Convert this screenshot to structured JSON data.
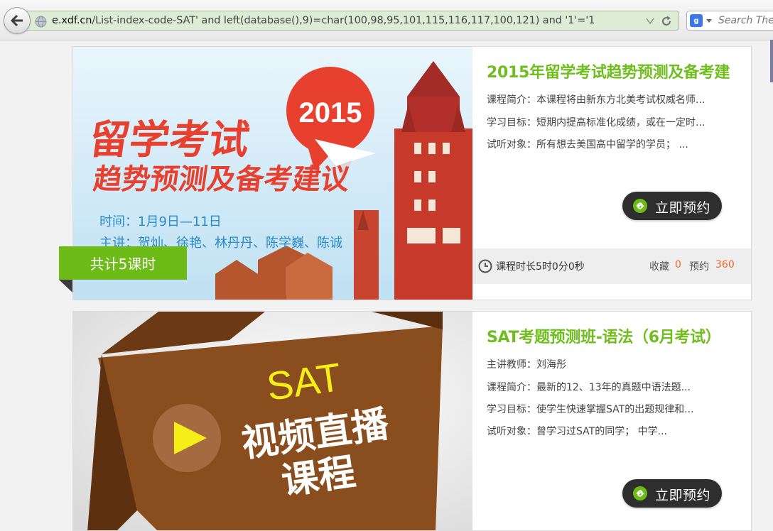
{
  "browser": {
    "url_domain": "e.xdf.cn",
    "url_path": "/List-index-code-SAT' and left(database(),9)=char(100,98,95,101,115,116,117,100,121) and '1'='1",
    "search_placeholder": "Search The",
    "search_engine_letter": "g"
  },
  "courses": [
    {
      "title": "2015年留学考试趋势预测及备考建",
      "lines": [
        "课程简介：本课程将由新东方北美考试权威名师...",
        "学习目标：短期内提高标准化成绩，或在一定时...",
        "试听对象：所有想去美国高中留学的学员； ..."
      ],
      "book_label": "立即预约",
      "lesson_badge": "共计5课时",
      "duration": "课程时长5时0分0秒",
      "favorites_label": "收藏",
      "favorites_count": "0",
      "bookings_label": "预约",
      "bookings_count": "360",
      "banner": {
        "year": "2015",
        "headline1": "留学考试",
        "headline2": "趋势预测及备考建议",
        "time": "时间：1月9日—11日",
        "speakers": "主讲：贺灿、徐艳、林丹丹、陈学巍、陈诚"
      }
    },
    {
      "title": "SAT考题预测班-语法（6月考试）",
      "lines": [
        "主讲教师：刘海彤",
        "课程简介：最新的12、13年的真题中语法题...",
        "学习目标：使学生快速掌握SAT的出题规律和...",
        "试听对象：曾学习过SAT的同学； 中学..."
      ],
      "book_label": "立即预约",
      "banner": {
        "line1": "SAT",
        "line2": "视频直播",
        "line3": "课程"
      }
    }
  ],
  "colors": {
    "title_green": "#6fbe1e",
    "badge_green": "#6dbb16",
    "count_orange": "#f26522",
    "button_dark": "#2e2e2e"
  },
  "icons": [
    "back-arrow-icon",
    "globe-icon",
    "dropdown-arrow-icon",
    "reload-icon",
    "google-icon",
    "link-icon",
    "clock-icon",
    "play-icon"
  ]
}
